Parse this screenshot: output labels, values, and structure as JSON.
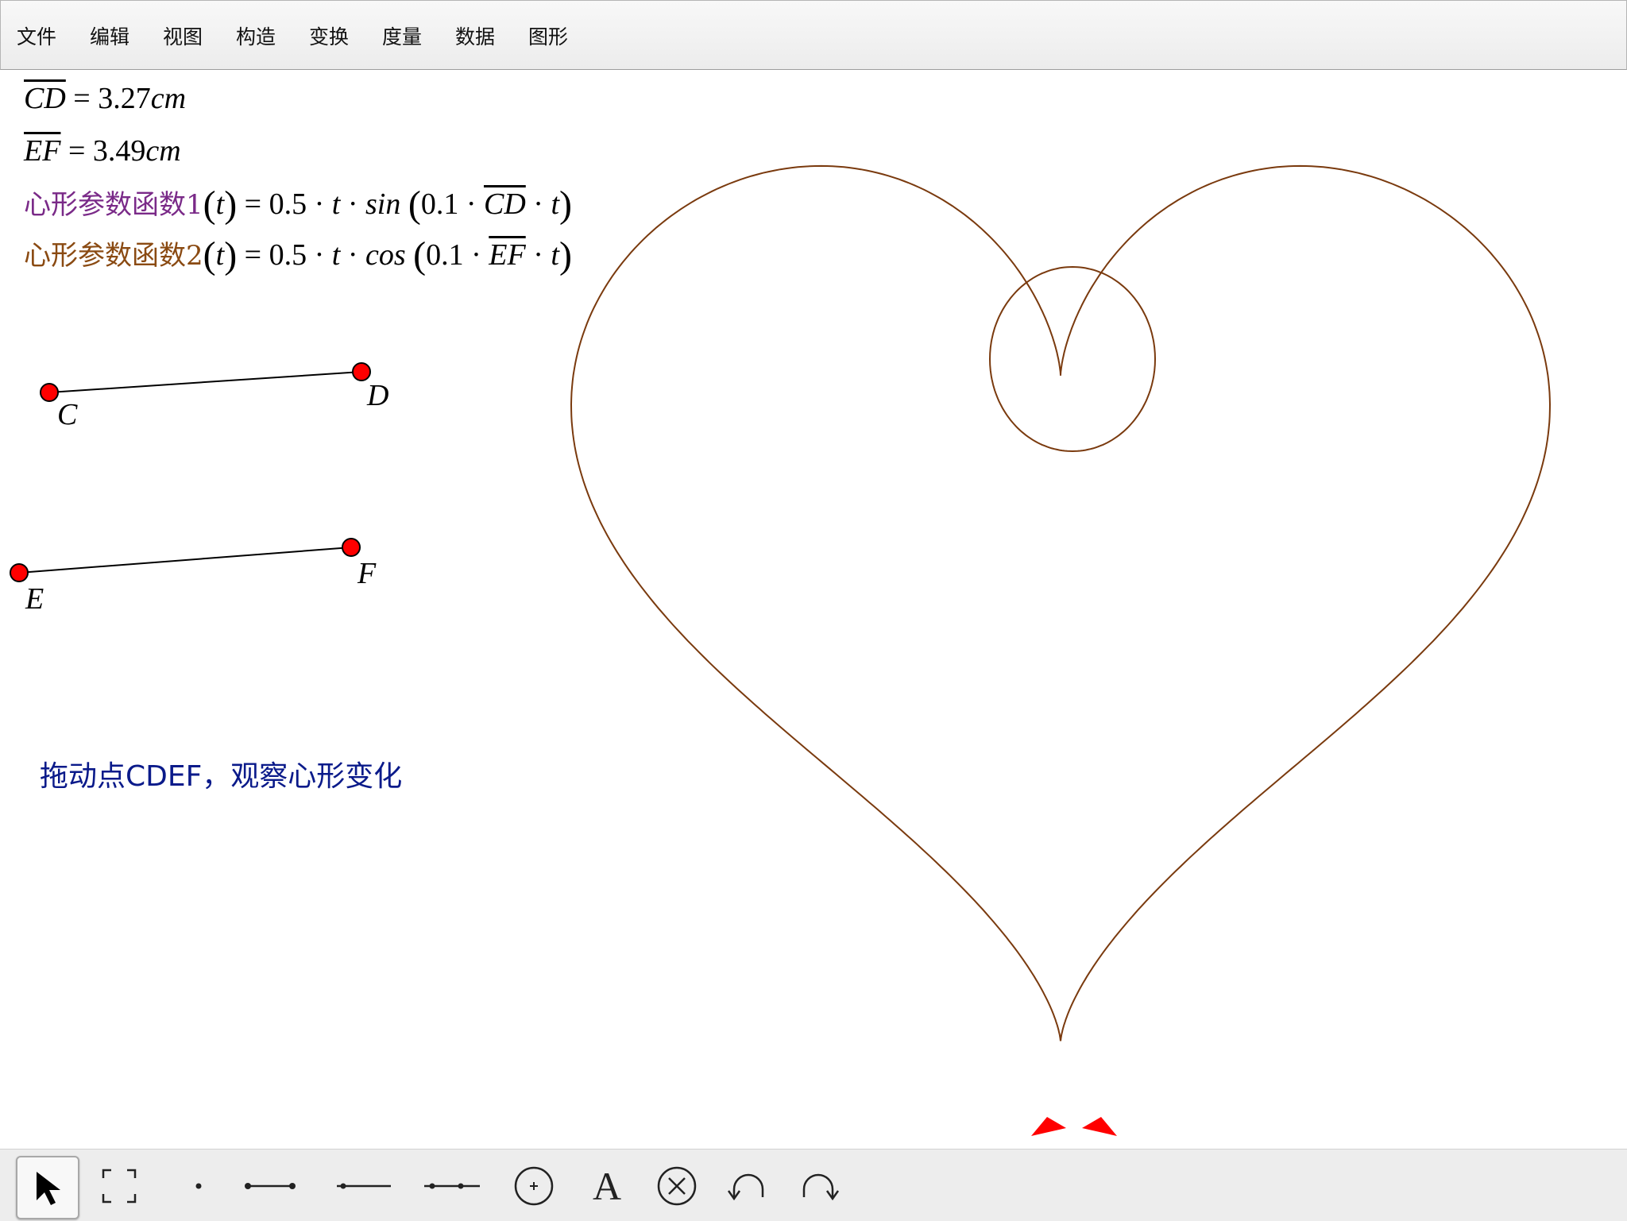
{
  "menu": [
    "文件",
    "编辑",
    "视图",
    "构造",
    "变换",
    "度量",
    "数据",
    "图形"
  ],
  "measurements": [
    {
      "segment": "CD",
      "eq": " = ",
      "value": "3.27",
      "unit": "cm"
    },
    {
      "segment": "EF",
      "eq": " = ",
      "value": "3.49",
      "unit": "cm"
    }
  ],
  "functions": [
    {
      "name": "心形参数函数1",
      "color": "#7a2a88",
      "arg": "t",
      "mid": "= 0.5 · ",
      "t": "t",
      "dot1": " · ",
      "trig": "sin",
      "inner": "0.1 · ",
      "seg": "CD",
      "tail": " · ",
      "t2": "t"
    },
    {
      "name": "心形参数函数2",
      "color": "#8a4a12",
      "arg": "t",
      "mid": "= 0.5 · ",
      "t": "t",
      "dot1": " · ",
      "trig": "cos",
      "inner": "0.1 · ",
      "seg": "EF",
      "tail": " · ",
      "t2": "t"
    }
  ],
  "points": {
    "C": "C",
    "D": "D",
    "E": "E",
    "F": "F"
  },
  "hint": "拖动点CDEF，观察心形变化",
  "colors": {
    "curve": "#7a3a0e",
    "point": "#ff0000",
    "hint": "#0a1a8a",
    "arrow": "#ff0000"
  },
  "toolbar": {
    "tools": [
      "arrow-select-icon",
      "marquee-select-icon",
      "point-icon",
      "segment-icon",
      "line-icon",
      "ray-icon",
      "circle-icon",
      "text-icon",
      "delete-icon",
      "undo-icon",
      "redo-icon"
    ],
    "selected": "arrow-select-icon",
    "text_tool_label": "A"
  }
}
